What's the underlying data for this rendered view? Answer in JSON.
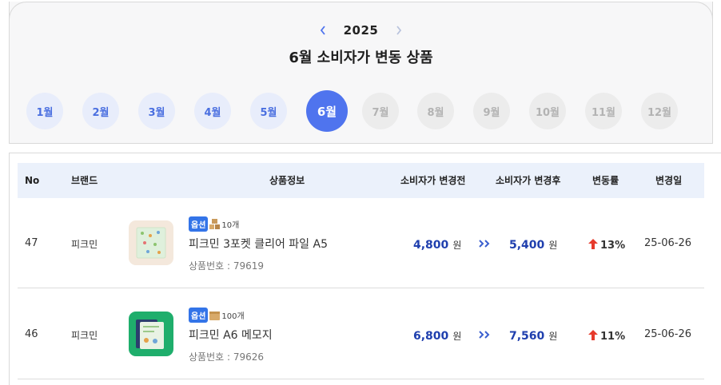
{
  "header": {
    "year": "2025",
    "title": "6월 소비자가 변동 상품",
    "months": [
      {
        "label": "1월",
        "state": "past"
      },
      {
        "label": "2월",
        "state": "past"
      },
      {
        "label": "3월",
        "state": "past"
      },
      {
        "label": "4월",
        "state": "past"
      },
      {
        "label": "5월",
        "state": "past"
      },
      {
        "label": "6월",
        "state": "active"
      },
      {
        "label": "7월",
        "state": "future"
      },
      {
        "label": "8월",
        "state": "future"
      },
      {
        "label": "9월",
        "state": "future"
      },
      {
        "label": "10월",
        "state": "future"
      },
      {
        "label": "11월",
        "state": "future"
      },
      {
        "label": "12월",
        "state": "future"
      }
    ]
  },
  "table": {
    "headers": {
      "no": "No",
      "brand": "브랜드",
      "product": "상품정보",
      "before": "소비자가 변경전",
      "after": "소비자가 변경후",
      "rate": "변동률",
      "date": "변경일"
    },
    "rows": [
      {
        "no": "47",
        "brand": "피크민",
        "option_badge": "옵션",
        "qty": "10개",
        "name": "피크민 3포켓 클리어 파일 A5",
        "code": "상품번호 : 79619",
        "before": "4,800",
        "after": "5,400",
        "unit": "원",
        "rate": "13%",
        "date": "25-06-26",
        "thumb_bg": "#f4e8dc",
        "thumb_item": "#dff0dc"
      },
      {
        "no": "46",
        "brand": "피크민",
        "option_badge": "옵션",
        "qty": "100개",
        "name": "피크민 A6 메모지",
        "code": "상품번호 : 79626",
        "before": "6,800",
        "after": "7,560",
        "unit": "원",
        "rate": "11%",
        "date": "25-06-26",
        "thumb_bg": "#1fae6c",
        "thumb_item": "#e9f2e4"
      }
    ]
  },
  "colors": {
    "accent": "#4f74ee",
    "price": "#1f3fae",
    "up_arrow": "#e63a2c",
    "badge": "#3374e8"
  }
}
